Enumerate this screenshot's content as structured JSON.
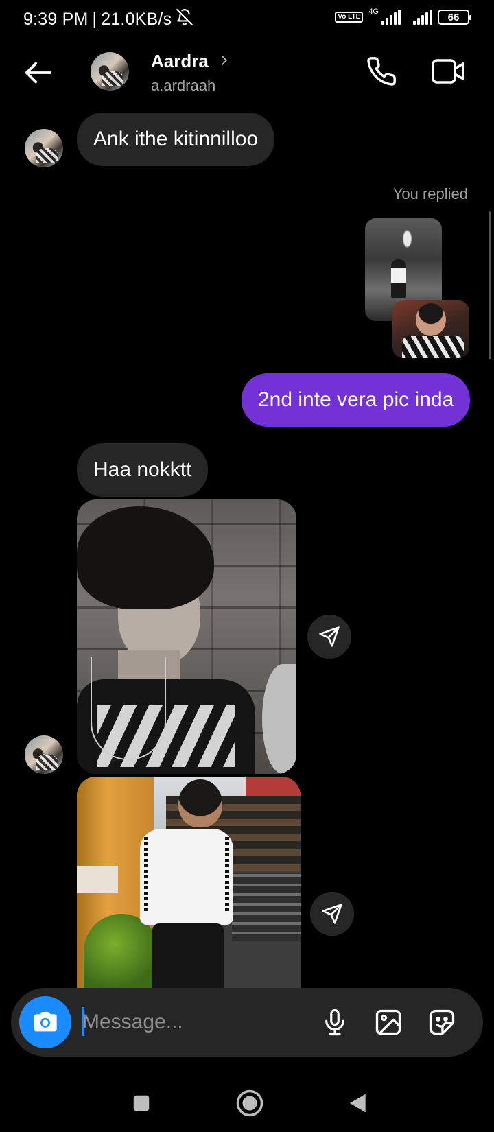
{
  "status_bar": {
    "time": "9:39 PM",
    "separator": "|",
    "speed": "21.0KB/s",
    "network": "4G",
    "volte": "Vo LTE",
    "battery": "66"
  },
  "header": {
    "contact_name": "Aardra",
    "contact_handle": "a.ardraah"
  },
  "thread": {
    "messages": [
      {
        "direction": "incoming",
        "type": "text",
        "text": "Ank ithe kitinnilloo"
      },
      {
        "direction": "outgoing",
        "type": "reply-label",
        "text": "You replied"
      },
      {
        "direction": "outgoing",
        "type": "text",
        "text": "2nd inte vera pic inda"
      },
      {
        "direction": "incoming",
        "type": "text",
        "text": "Haa nokktt"
      },
      {
        "direction": "incoming",
        "type": "photo"
      },
      {
        "direction": "incoming",
        "type": "photo"
      }
    ]
  },
  "composer": {
    "placeholder": "Message..."
  },
  "colors": {
    "outgoing_bubble": "#7232d6",
    "incoming_bubble": "#262626",
    "camera_button": "#1a8cff",
    "background": "#000000"
  },
  "icons": {
    "back": "arrow-left-icon",
    "call": "phone-icon",
    "video": "video-camera-icon",
    "share": "send-icon",
    "camera": "camera-icon",
    "mic": "microphone-icon",
    "gallery": "image-icon",
    "sticker": "sticker-icon",
    "mute": "bell-off-icon"
  }
}
